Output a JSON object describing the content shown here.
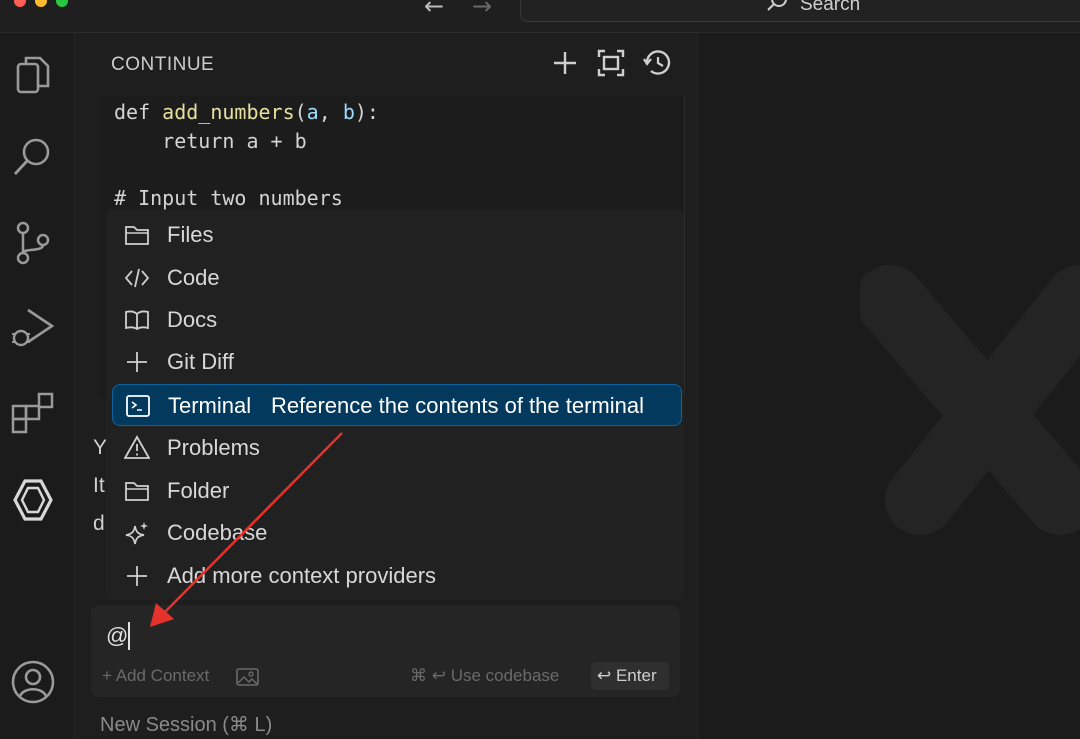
{
  "titlebar": {
    "search_label": "Search",
    "traffic_colors": [
      "#ff5f57",
      "#febc2e",
      "#28c840"
    ]
  },
  "activity_bar": {
    "icons": [
      "files-icon",
      "search-icon",
      "source-control-icon",
      "run-debug-icon",
      "extensions-icon",
      "continue-logo-icon",
      "account-icon"
    ]
  },
  "panel": {
    "title": "CONTINUE",
    "header_icons": [
      "plus-icon",
      "fullscreen-icon",
      "history-icon"
    ]
  },
  "code": {
    "line1_kw": "def ",
    "line1_fn": "add_numbers",
    "line1_open": "(",
    "line1_a": "a",
    "line1_sep": ", ",
    "line1_b": "b",
    "line1_close": "):",
    "line2": "    return a + b",
    "line3": "# Input two numbers"
  },
  "chat_fragments": [
    "Y",
    "It",
    "d"
  ],
  "context_menu": {
    "items": [
      {
        "label": "Files",
        "icon": "folder-icon"
      },
      {
        "label": "Code",
        "icon": "code-icon"
      },
      {
        "label": "Docs",
        "icon": "book-icon"
      },
      {
        "label": "Git Diff",
        "icon": "plus-icon"
      },
      {
        "label": "Terminal",
        "description": "Reference the contents of the terminal",
        "icon": "terminal-icon",
        "selected": true
      },
      {
        "label": "Problems",
        "icon": "warning-icon"
      },
      {
        "label": "Folder",
        "icon": "folder-icon"
      },
      {
        "label": "Codebase",
        "icon": "sparkle-icon"
      },
      {
        "label": "Add more context providers",
        "icon": "plus-icon"
      }
    ]
  },
  "input": {
    "value": "@",
    "add_context": "+ Add Context",
    "use_codebase": "⌘ ↩ Use codebase",
    "enter": "↩ Enter"
  },
  "new_session": "New Session (⌘ L)",
  "colors": {
    "selection_bg": "#04395e",
    "selection_border": "#0e639c",
    "annotation_arrow": "#e5322d"
  }
}
